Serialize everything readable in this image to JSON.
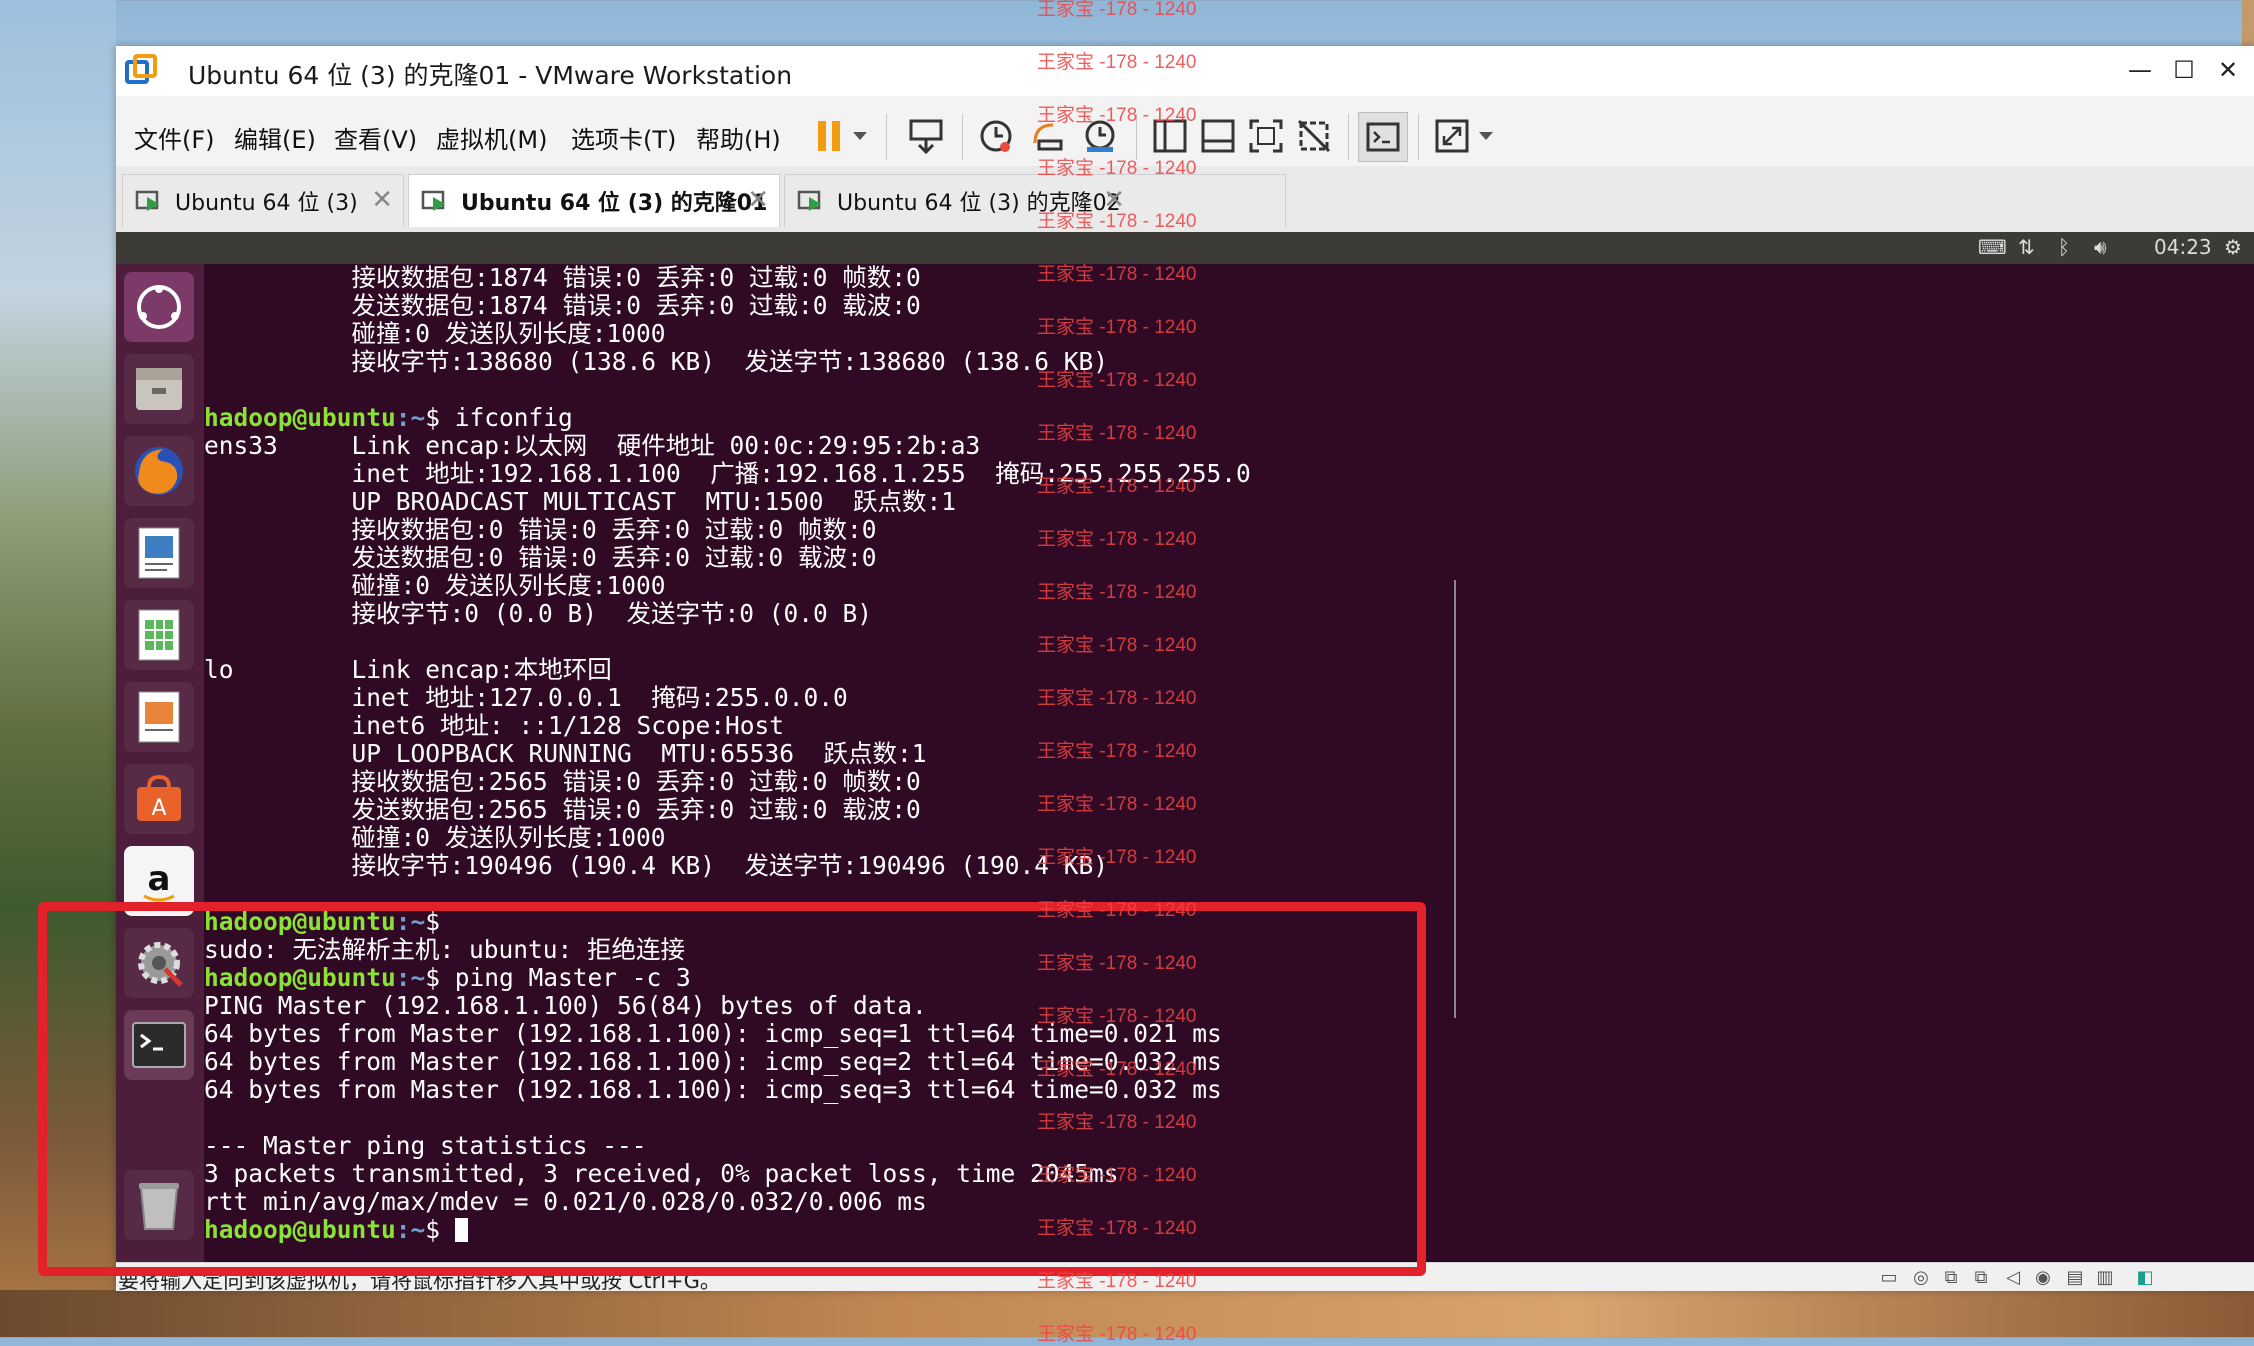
{
  "window": {
    "title": "Ubuntu 64 位 (3) 的克隆01 - VMware Workstation",
    "minimize": "—",
    "maximize": "☐",
    "close": "✕"
  },
  "menu": [
    "文件(F)",
    "编辑(E)",
    "查看(V)",
    "虚拟机(M)",
    "选项卡(T)",
    "帮助(H)"
  ],
  "tabs": [
    {
      "label": "Ubuntu 64 位 (3)",
      "active": false
    },
    {
      "label": "Ubuntu 64 位 (3) 的克隆01",
      "active": true
    },
    {
      "label": "Ubuntu 64 位 (3) 的克隆02",
      "active": false
    }
  ],
  "guest_topbar": {
    "clock": "04:23"
  },
  "terminal": {
    "lines": [
      "          接收数据包:1874 错误:0 丢弃:0 过载:0 帧数:0",
      "          发送数据包:1874 错误:0 丢弃:0 过载:0 载波:0",
      "          碰撞:0 发送队列长度:1000",
      "          接收字节:138680 (138.6 KB)  发送字节:138680 (138.6 KB)",
      "",
      {
        "user": "hadoop@ubuntu",
        "path": ":~",
        "cmd": "$ ifconfig"
      },
      "ens33     Link encap:以太网  硬件地址 00:0c:29:95:2b:a3",
      "          inet 地址:192.168.1.100  广播:192.168.1.255  掩码:255.255.255.0",
      "          UP BROADCAST MULTICAST  MTU:1500  跃点数:1",
      "          接收数据包:0 错误:0 丢弃:0 过载:0 帧数:0",
      "          发送数据包:0 错误:0 丢弃:0 过载:0 载波:0",
      "          碰撞:0 发送队列长度:1000",
      "          接收字节:0 (0.0 B)  发送字节:0 (0.0 B)",
      "",
      "lo        Link encap:本地环回",
      "          inet 地址:127.0.0.1  掩码:255.0.0.0",
      "          inet6 地址: ::1/128 Scope:Host",
      "          UP LOOPBACK RUNNING  MTU:65536  跃点数:1",
      "          接收数据包:2565 错误:0 丢弃:0 过载:0 帧数:0",
      "          发送数据包:2565 错误:0 丢弃:0 过载:0 载波:0",
      "          碰撞:0 发送队列长度:1000",
      "          接收字节:190496 (190.4 KB)  发送字节:190496 (190.4 KB)",
      "",
      {
        "user": "hadoop@ubuntu",
        "path": ":~",
        "cmd": "$ "
      },
      "sudo: 无法解析主机: ubuntu: 拒绝连接",
      {
        "user": "hadoop@ubuntu",
        "path": ":~",
        "cmd": "$ ping Master -c 3"
      },
      "PING Master (192.168.1.100) 56(84) bytes of data.",
      "64 bytes from Master (192.168.1.100): icmp_seq=1 ttl=64 time=0.021 ms",
      "64 bytes from Master (192.168.1.100): icmp_seq=2 ttl=64 time=0.032 ms",
      "64 bytes from Master (192.168.1.100): icmp_seq=3 ttl=64 time=0.032 ms",
      "",
      "--- Master ping statistics ---",
      "3 packets transmitted, 3 received, 0% packet loss, time 2045ms",
      "rtt min/avg/max/mdev = 0.021/0.028/0.032/0.006 ms",
      {
        "user": "hadoop@ubuntu",
        "path": ":~",
        "cmd": "$ "
      }
    ]
  },
  "statusbar": {
    "text": "要将输入定向到该虚拟机，请将鼠标指针移入其中或按 Ctrl+G。"
  },
  "watermark": "王家宝 -178 - 1240",
  "colors": {
    "terminal_bg": "#300a24",
    "prompt_user": "#8ae234",
    "prompt_path": "#729fcf",
    "launcher_bg": "#4d1e3b",
    "highlight": "#e3212b"
  }
}
